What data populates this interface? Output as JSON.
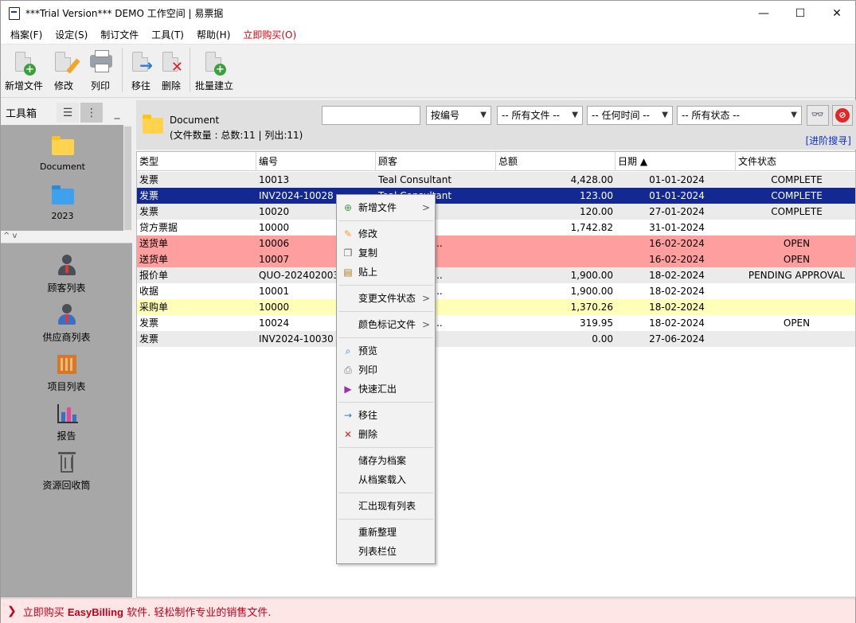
{
  "window": {
    "title": "***Trial Version*** DEMO 工作空间 | 易票据",
    "minimize": "—",
    "maximize": "☐",
    "close": "✕"
  },
  "menu": [
    "档案(F)",
    "设定(S)",
    "制订文件",
    "工具(T)",
    "帮助(H)"
  ],
  "menu_buy": "立即购买(O)",
  "toolbar": {
    "new_doc": "新增文件",
    "edit": "修改",
    "print": "列印",
    "move": "移往",
    "delete": "删除",
    "batch": "批量建立"
  },
  "left_panel": {
    "title": "工具箱",
    "folders": [
      "Document",
      "2023"
    ],
    "collapse_glyph": "^ v",
    "nav": [
      "顾客列表",
      "供应商列表",
      "项目列表",
      "报告",
      "资源回收筒"
    ]
  },
  "doc_header": {
    "title": "Document",
    "count": "(文件数量 : 总数:11 | 列出:11)",
    "search_value": "",
    "sort_by": "按编号",
    "file_filter": "-- 所有文件 --",
    "time_filter": "-- 任何时间 --",
    "status_filter": "-- 所有状态 --",
    "advanced_search": "[进阶搜寻]",
    "bino_glyph": "👓",
    "clear_glyph": "⊘"
  },
  "table": {
    "columns": [
      "类型",
      "编号",
      "顾客",
      "总额",
      "日期 ▲",
      "文件状态"
    ],
    "rows": [
      {
        "type": "发票",
        "no": "10013",
        "customer": "Teal Consultant",
        "amount": "4,428.00",
        "date": "01-01-2024",
        "status": "COMPLETE",
        "style": "row-gray"
      },
      {
        "type": "发票",
        "no": "INV2024-10028",
        "customer": "Teal Consultant",
        "amount": "123.00",
        "date": "01-01-2024",
        "status": "COMPLETE",
        "style": "row-sel"
      },
      {
        "type": "发票",
        "no": "10020",
        "customer": "Co",
        "amount": "120.00",
        "date": "27-01-2024",
        "status": "COMPLETE",
        "style": "row-gray"
      },
      {
        "type": "贷方票据",
        "no": "10000",
        "customer": "up",
        "amount": "1,742.82",
        "date": "31-01-2024",
        "status": "",
        "style": "row-white"
      },
      {
        "type": "送货单",
        "no": "10006",
        "customer": "elopment C...",
        "amount": "",
        "date": "16-02-2024",
        "status": "OPEN",
        "style": "row-red"
      },
      {
        "type": "送货单",
        "no": "10007",
        "customer": "Man",
        "amount": "",
        "date": "16-02-2024",
        "status": "OPEN",
        "style": "row-red"
      },
      {
        "type": "报价单",
        "no": "QUO-202402003",
        "customer": "elopment C...",
        "amount": "1,900.00",
        "date": "18-02-2024",
        "status": "PENDING APPROVAL",
        "style": "row-gray"
      },
      {
        "type": "收据",
        "no": "10001",
        "customer": "elopment C...",
        "amount": "1,900.00",
        "date": "18-02-2024",
        "status": "",
        "style": "row-white"
      },
      {
        "type": "采购单",
        "no": "10000",
        "customer": "td",
        "amount": "1,370.26",
        "date": "18-02-2024",
        "status": "",
        "style": "row-yellow"
      },
      {
        "type": "发票",
        "no": "10024",
        "customer": "elopment C...",
        "amount": "319.95",
        "date": "18-02-2024",
        "status": "OPEN",
        "style": "row-white"
      },
      {
        "type": "发票",
        "no": "INV2024-10030",
        "customer": "",
        "amount": "0.00",
        "date": "27-06-2024",
        "status": "",
        "style": "row-gray"
      }
    ]
  },
  "context_menu": {
    "new_doc": "新增文件",
    "edit": "修改",
    "copy": "复制",
    "paste": "贴上",
    "change_status": "变更文件状态",
    "color_mark": "颜色标记文件",
    "preview": "预览",
    "print": "列印",
    "quick_export": "快速汇出",
    "move": "移往",
    "delete": "删除",
    "save_archive": "储存为档案",
    "load_archive": "从档案载入",
    "export_list": "汇出现有列表",
    "refresh": "重新整理",
    "list_columns": "列表栏位",
    "submenu_glyph": ">"
  },
  "status_bar": {
    "prefix": "立即购买",
    "brand": "EasyBilling",
    "suffix": "软件. 轻松制作专业的销售文件."
  },
  "colors": {
    "selected_row": "#142891",
    "red_row": "#ff9e9e",
    "yellow_row": "#ffffb8",
    "buy_red": "#d8000c"
  }
}
